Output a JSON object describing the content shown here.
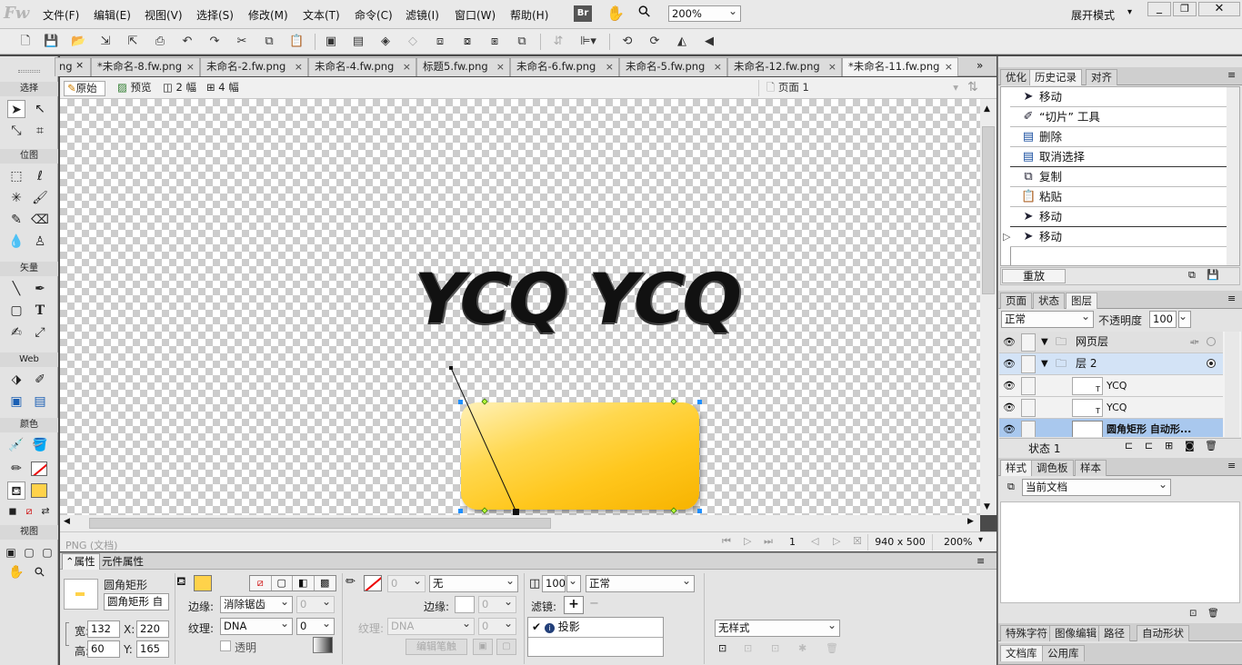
{
  "app": {
    "logo": "Fw",
    "workspace": "展开模式",
    "zoom": "200%"
  },
  "menus": [
    "文件(F)",
    "编辑(E)",
    "视图(V)",
    "选择(S)",
    "修改(M)",
    "文本(T)",
    "命令(C)",
    "滤镜(I)",
    "窗口(W)",
    "帮助(H)"
  ],
  "menu_br": "Br",
  "tools": {
    "sections": {
      "select": "选择",
      "bitmap": "位图",
      "vector": "矢量",
      "web": "Web",
      "color": "颜色",
      "view": "视图"
    }
  },
  "tabs": [
    "ng",
    "*未命名-8.fw.png",
    "未命名-2.fw.png",
    "未命名-4.fw.png",
    "标题5.fw.png",
    "未命名-6.fw.png",
    "未命名-5.fw.png",
    "未命名-12.fw.png",
    "*未命名-11.fw.png"
  ],
  "tab_close": "×",
  "viewbar": {
    "original": "原始",
    "preview": "预览",
    "two_up": "2 幅",
    "four_up": "4 幅",
    "page": "页面 1"
  },
  "canvas": {
    "text": "YCQ YCQ"
  },
  "status": {
    "doc_type": "PNG (文档)",
    "frame": "1",
    "size": "940 x 500",
    "zoom": "200%"
  },
  "props": {
    "tab_props": "属性",
    "tab_symbol": "元件属性",
    "obj_type": "圆角矩形",
    "obj_name": "圆角矩形 自",
    "w_label": "宽:",
    "w": "132",
    "x_label": "X:",
    "x": "220",
    "h_label": "高:",
    "h": "60",
    "y_label": "Y:",
    "y": "165",
    "edge_label": "边缘:",
    "edge_value": "消除锯齿",
    "edge_num": "0",
    "texture_label": "纹理:",
    "texture_value": "DNA",
    "texture_num": "0",
    "transparent": "透明",
    "stroke_size": "0",
    "stroke_type": "无",
    "stroke_edge_label": "边缘:",
    "stroke_edge_num": "0",
    "stroke_texture_label": "纹理:",
    "stroke_texture_value": "DNA",
    "stroke_texture_num": "0",
    "edit_stroke": "编辑笔触",
    "opacity": "100",
    "blend": "正常",
    "filters_label": "滤镜:",
    "filter_add": "+",
    "filter_remove": "−",
    "filter_item": "投影",
    "style": "无样式"
  },
  "right": {
    "top_tabs": [
      "优化",
      "历史记录",
      "对齐"
    ],
    "history": [
      "移动",
      "“切片” 工具",
      "删除",
      "取消选择",
      "复制",
      "粘贴",
      "移动",
      "移动"
    ],
    "replay": "重放",
    "layer_tabs": [
      "页面",
      "状态",
      "图层"
    ],
    "blend": "正常",
    "opacity_label": "不透明度",
    "opacity": "100",
    "layers": [
      "网页层",
      "层 2",
      "YCQ",
      "YCQ",
      "圆角矩形 自动形..."
    ],
    "state": "状态 1",
    "style_tabs": [
      "样式",
      "调色板",
      "样本"
    ],
    "style_dd": "当前文档",
    "bottom_tabs": [
      "特殊字符",
      "图像编辑",
      "路径",
      "自动形状"
    ],
    "lib_tabs": [
      "文档库",
      "公用库"
    ]
  },
  "colors": {
    "fill": "#ffd24a",
    "selection": "#0a6bd6",
    "panel": "#e3e3e3"
  }
}
